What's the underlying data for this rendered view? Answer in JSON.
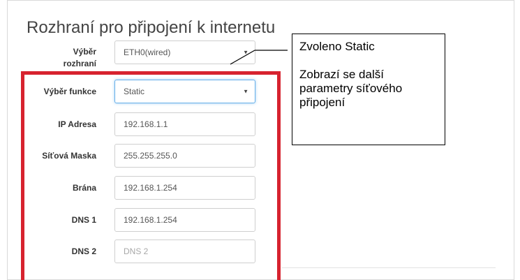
{
  "page": {
    "title": "Rozhraní pro připojení k internetu"
  },
  "form": {
    "interface": {
      "label": "Výběr rozhraní",
      "value": "ETH0(wired)"
    },
    "function": {
      "label": "Výběr funkce",
      "value": "Static"
    },
    "ip": {
      "label": "IP Adresa",
      "value": "192.168.1.1"
    },
    "mask": {
      "label": "Síťová Maska",
      "value": "255.255.255.0"
    },
    "gateway": {
      "label": "Brána",
      "value": "192.168.1.254"
    },
    "dns1": {
      "label": "DNS 1",
      "value": "192.168.1.254"
    },
    "dns2": {
      "label": "DNS 2",
      "value": "",
      "placeholder": "DNS 2"
    }
  },
  "callout": {
    "line1": "Zvoleno Static",
    "line2": "Zobrazí se další parametry síťového připojení"
  },
  "icons": {
    "select_arrow": "triangle-down-icon"
  },
  "colors": {
    "highlight": "#d7232f",
    "focus": "#66afe9"
  }
}
